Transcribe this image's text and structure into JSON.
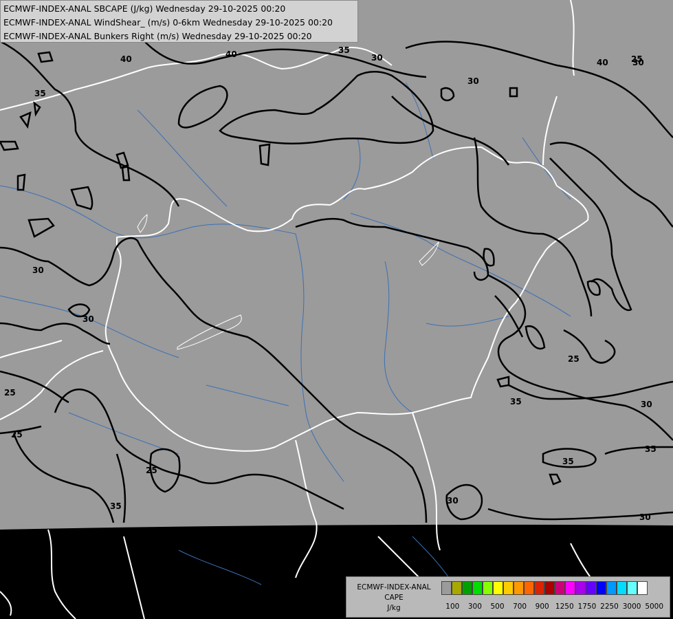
{
  "titles": {
    "line1": "ECMWF-INDEX-ANAL SBCAPE (J/kg) Wednesday 29-10-2025 00:20",
    "line2": "ECMWF-INDEX-ANAL WindShear_ (m/s) 0-6km Wednesday 29-10-2025 00:20",
    "line3": "ECMWF-INDEX-ANAL Bunkers Right (m/s) Wednesday 29-10-2025 00:20"
  },
  "legend": {
    "title1": "ECMWF-INDEX-ANAL",
    "title2": "CAPE",
    "title3": "J/kg",
    "colors": [
      "#9b9b9b",
      "#a8a800",
      "#00a000",
      "#00dd00",
      "#88ff00",
      "#ffff00",
      "#ffcc00",
      "#ff9900",
      "#ff6600",
      "#dd2200",
      "#aa0000",
      "#cc0077",
      "#ff00ff",
      "#aa00ee",
      "#6600ff",
      "#0000ff",
      "#0099ff",
      "#00ddff",
      "#66ffff",
      "#ffffff"
    ],
    "ticks": [
      "100",
      "300",
      "500",
      "700",
      "900",
      "1250",
      "1750",
      "2250",
      "3000",
      "5000"
    ]
  },
  "contour_labels": [
    "40",
    "35",
    "30",
    "25",
    "40",
    "35",
    "30",
    "25",
    "30",
    "35",
    "30",
    "40",
    "35",
    "30",
    "25",
    "25",
    "25",
    "35",
    "30",
    "30",
    "35",
    "30"
  ],
  "colors": {
    "land": "#9b9b9b",
    "outside": "#000000",
    "border": "#ffffff",
    "river": "#3a6fb5",
    "contour": "#000000"
  }
}
